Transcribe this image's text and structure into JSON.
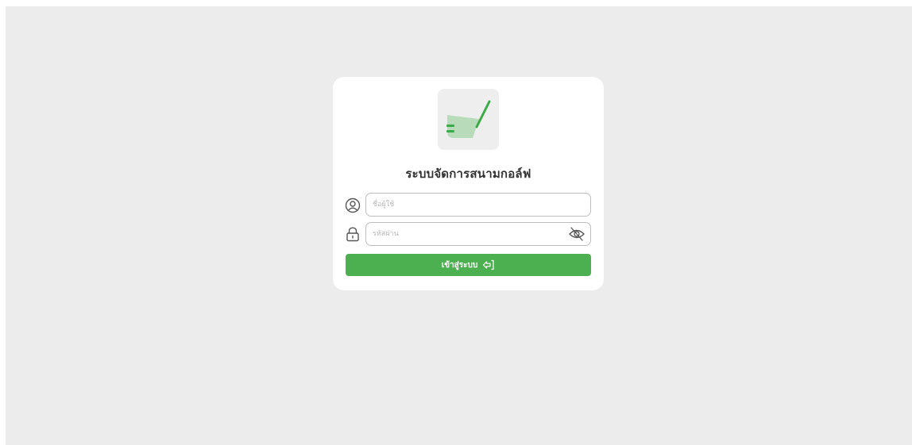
{
  "app": {
    "title": "ระบบจัดการสนามกอล์ฟ"
  },
  "logo": {
    "icon": "golf-club-icon",
    "colors": {
      "box_bg": "#eeeeee",
      "club_head": "#b8dcb9",
      "shaft": "#3daa4a",
      "grooves": "#3daa4a"
    }
  },
  "login_form": {
    "username": {
      "icon": "user-circle-icon",
      "placeholder": "ชื่อผู้ใช้",
      "value": ""
    },
    "password": {
      "icon": "lock-icon",
      "placeholder": "รหัสผ่าน",
      "value": "",
      "toggle_icon": "eye-off-icon"
    },
    "submit": {
      "label": "เข้าสู่ระบบ",
      "icon": "login-icon",
      "color": "#4caf50"
    }
  },
  "colors": {
    "page_bg": "#ececec",
    "card_bg": "#ffffff",
    "border": "#bdbdbd"
  }
}
